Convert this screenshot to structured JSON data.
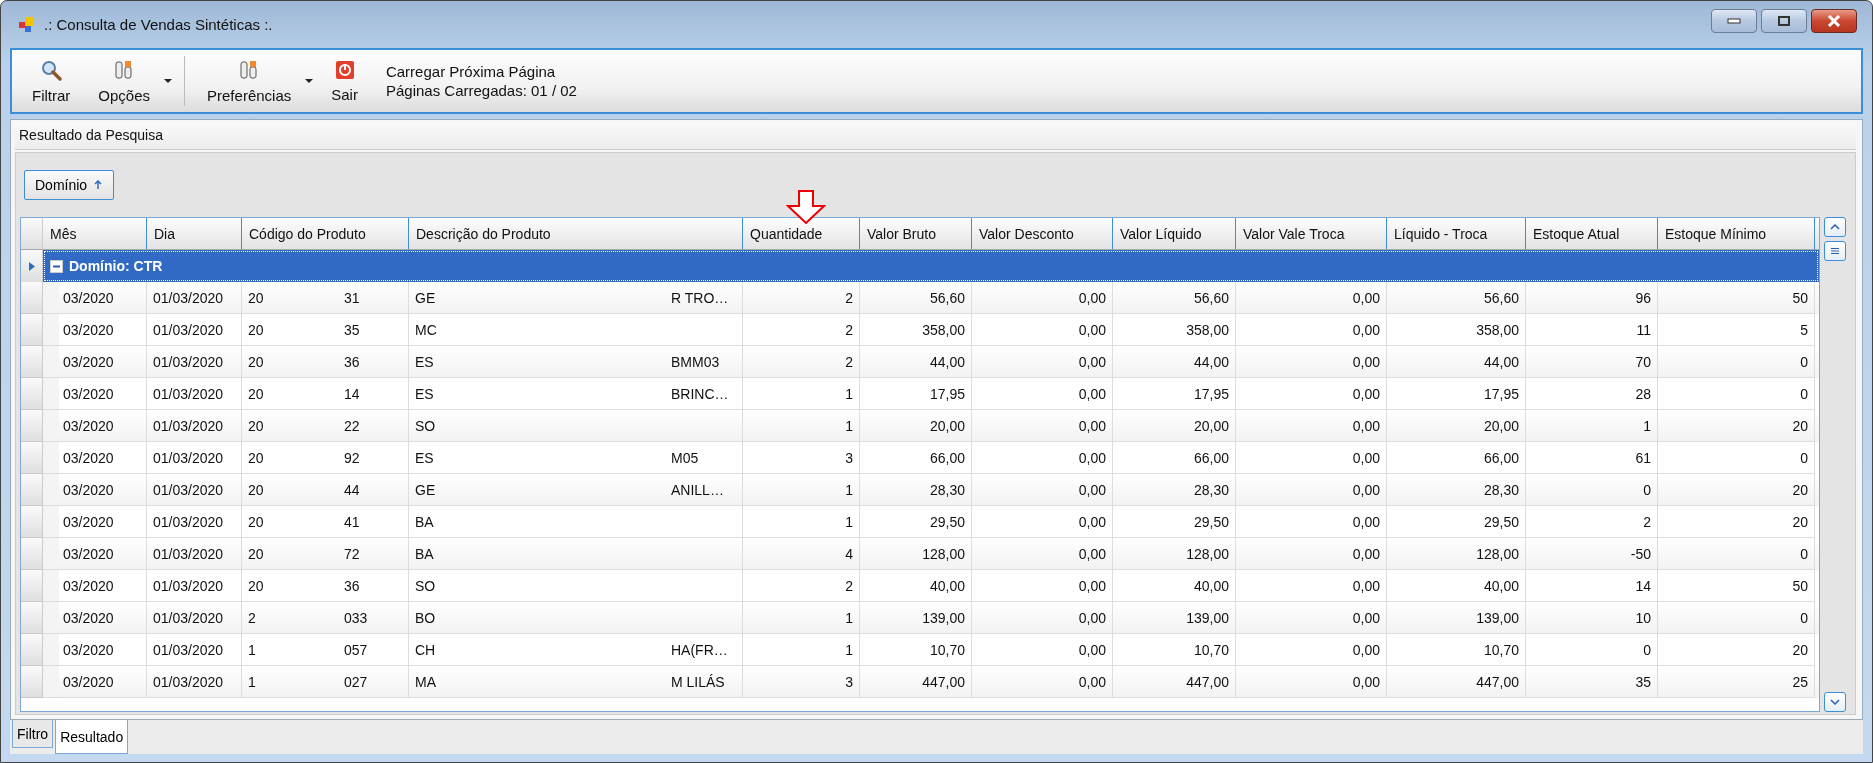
{
  "window": {
    "title": ".: Consulta de Vendas Sintéticas :."
  },
  "toolbar": {
    "buttons": [
      {
        "label": "Filtrar",
        "kind": "search",
        "dropdown": false
      },
      {
        "label": "Opções",
        "kind": "tools",
        "dropdown": true
      },
      {
        "label": "Preferências",
        "kind": "tools",
        "dropdown": true
      },
      {
        "label": "Sair",
        "kind": "exit",
        "dropdown": false
      }
    ],
    "info": [
      "Carregar Próxima Página",
      "Páginas Carregadas: 01 / 02"
    ]
  },
  "panel": {
    "title": "Resultado da Pesquisa",
    "group_button": {
      "label": "Domínio"
    },
    "table": {
      "columns": [
        "Mês",
        "Dia",
        "Código do Produto",
        "Descrição do Produto",
        "Quantidade",
        "Valor Bruto",
        "Valor Desconto",
        "Valor Líquido",
        "Valor Vale Troca",
        "Líquido - Troca",
        "Estoque Atual",
        "Estoque Mínimo"
      ],
      "group": {
        "label": "Domínio: CTR",
        "expanded": true,
        "selected": true
      },
      "rows": [
        {
          "cells": [
            "03/2020",
            "01/03/2020",
            [
              "20",
              "31"
            ],
            [
              "GE",
              "R TRO…"
            ],
            "2",
            "56,60",
            "0,00",
            "56,60",
            "0,00",
            "56,60",
            "96",
            "50"
          ]
        },
        {
          "cells": [
            "03/2020",
            "01/03/2020",
            [
              "20",
              "35"
            ],
            [
              "MC"
            ],
            "2",
            "358,00",
            "0,00",
            "358,00",
            "0,00",
            "358,00",
            "11",
            "5"
          ]
        },
        {
          "cells": [
            "03/2020",
            "01/03/2020",
            [
              "20",
              "36"
            ],
            [
              "ES",
              "BMM03"
            ],
            "2",
            "44,00",
            "0,00",
            "44,00",
            "0,00",
            "44,00",
            "70",
            "0"
          ]
        },
        {
          "cells": [
            "03/2020",
            "01/03/2020",
            [
              "20",
              "14"
            ],
            [
              "ES",
              "BRINC…"
            ],
            "1",
            "17,95",
            "0,00",
            "17,95",
            "0,00",
            "17,95",
            "28",
            "0"
          ]
        },
        {
          "cells": [
            "03/2020",
            "01/03/2020",
            [
              "20",
              "22"
            ],
            [
              "SO"
            ],
            "1",
            "20,00",
            "0,00",
            "20,00",
            "0,00",
            "20,00",
            "1",
            "20"
          ]
        },
        {
          "cells": [
            "03/2020",
            "01/03/2020",
            [
              "20",
              "92"
            ],
            [
              "ES",
              "M05"
            ],
            "3",
            "66,00",
            "0,00",
            "66,00",
            "0,00",
            "66,00",
            "61",
            "0"
          ]
        },
        {
          "cells": [
            "03/2020",
            "01/03/2020",
            [
              "20",
              "44"
            ],
            [
              "GE",
              "ANILL…"
            ],
            "1",
            "28,30",
            "0,00",
            "28,30",
            "0,00",
            "28,30",
            "0",
            "20"
          ]
        },
        {
          "cells": [
            "03/2020",
            "01/03/2020",
            [
              "20",
              "41"
            ],
            [
              "BA"
            ],
            "1",
            "29,50",
            "0,00",
            "29,50",
            "0,00",
            "29,50",
            "2",
            "20"
          ]
        },
        {
          "cells": [
            "03/2020",
            "01/03/2020",
            [
              "20",
              "72"
            ],
            [
              "BA"
            ],
            "4",
            "128,00",
            "0,00",
            "128,00",
            "0,00",
            "128,00",
            "-50",
            "0"
          ]
        },
        {
          "cells": [
            "03/2020",
            "01/03/2020",
            [
              "20",
              "36"
            ],
            [
              "SO"
            ],
            "2",
            "40,00",
            "0,00",
            "40,00",
            "0,00",
            "40,00",
            "14",
            "50"
          ]
        },
        {
          "cells": [
            "03/2020",
            "01/03/2020",
            [
              "2",
              "033"
            ],
            [
              "BO"
            ],
            "1",
            "139,00",
            "0,00",
            "139,00",
            "0,00",
            "139,00",
            "10",
            "0"
          ]
        },
        {
          "cells": [
            "03/2020",
            "01/03/2020",
            [
              "1",
              "057"
            ],
            [
              "CH",
              "HA(FR…"
            ],
            "1",
            "10,70",
            "0,00",
            "10,70",
            "0,00",
            "10,70",
            "0",
            "20"
          ]
        },
        {
          "cells": [
            "03/2020",
            "01/03/2020",
            [
              "1",
              "027"
            ],
            [
              "MA",
              "M LILÁS"
            ],
            "3",
            "447,00",
            "0,00",
            "447,00",
            "0,00",
            "447,00",
            "35",
            "25"
          ]
        }
      ]
    }
  },
  "tabs": [
    {
      "label": "Filtro",
      "selected": false
    },
    {
      "label": "Resultado",
      "selected": true
    }
  ]
}
